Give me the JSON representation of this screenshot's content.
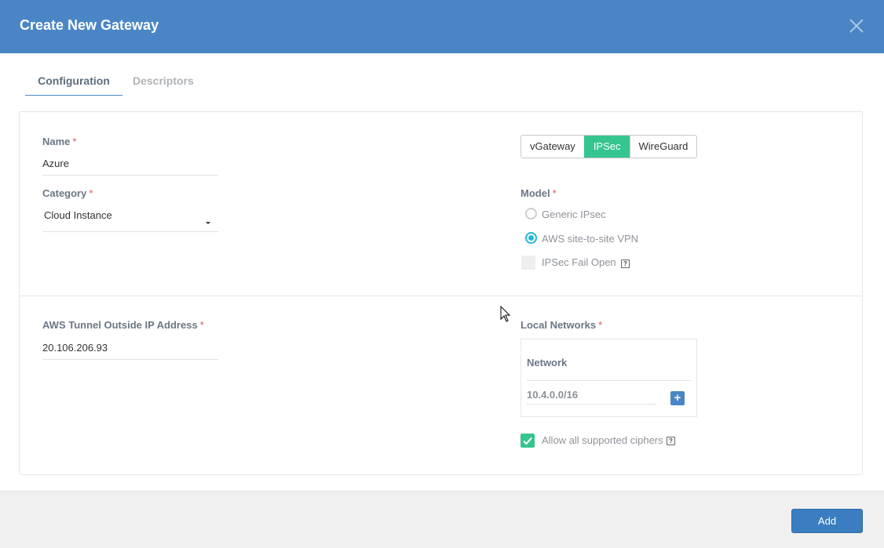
{
  "header": {
    "title": "Create New Gateway"
  },
  "tabs": [
    {
      "label": "Configuration",
      "active": true
    },
    {
      "label": "Descriptors",
      "active": false
    }
  ],
  "required_mark": "*",
  "form": {
    "name": {
      "label": "Name",
      "value": "Azure"
    },
    "category": {
      "label": "Category",
      "value": "Cloud Instance"
    },
    "gateway_type": {
      "options": [
        "vGateway",
        "IPSec",
        "WireGuard"
      ],
      "selected": "IPSec"
    },
    "model": {
      "label": "Model",
      "options": [
        {
          "label": "Generic IPsec",
          "selected": false
        },
        {
          "label": "AWS site-to-site VPN",
          "selected": true
        }
      ]
    },
    "ipsec_fail_open": {
      "label": "IPSec Fail Open",
      "checked": false
    },
    "aws_tunnel_ip": {
      "label": "AWS Tunnel Outside IP Address",
      "value": "20.106.206.93"
    },
    "local_networks": {
      "label": "Local Networks",
      "column_header": "Network",
      "rows": [
        "10.4.0.0/16"
      ]
    },
    "allow_ciphers": {
      "label": "Allow all supported ciphers",
      "checked": true
    }
  },
  "help_glyph": "?",
  "plus_glyph": "+",
  "footer": {
    "add_label": "Add"
  },
  "colors": {
    "header": "#4a86c5",
    "accent_green": "#36c590",
    "radio_blue": "#29b6d8",
    "required_red": "#e05555",
    "primary_button": "#3a7dc0"
  },
  "icons": {
    "close": "close-icon",
    "help": "help-icon",
    "plus": "plus-icon",
    "dropdown": "caret-down-icon",
    "check": "check-icon"
  }
}
